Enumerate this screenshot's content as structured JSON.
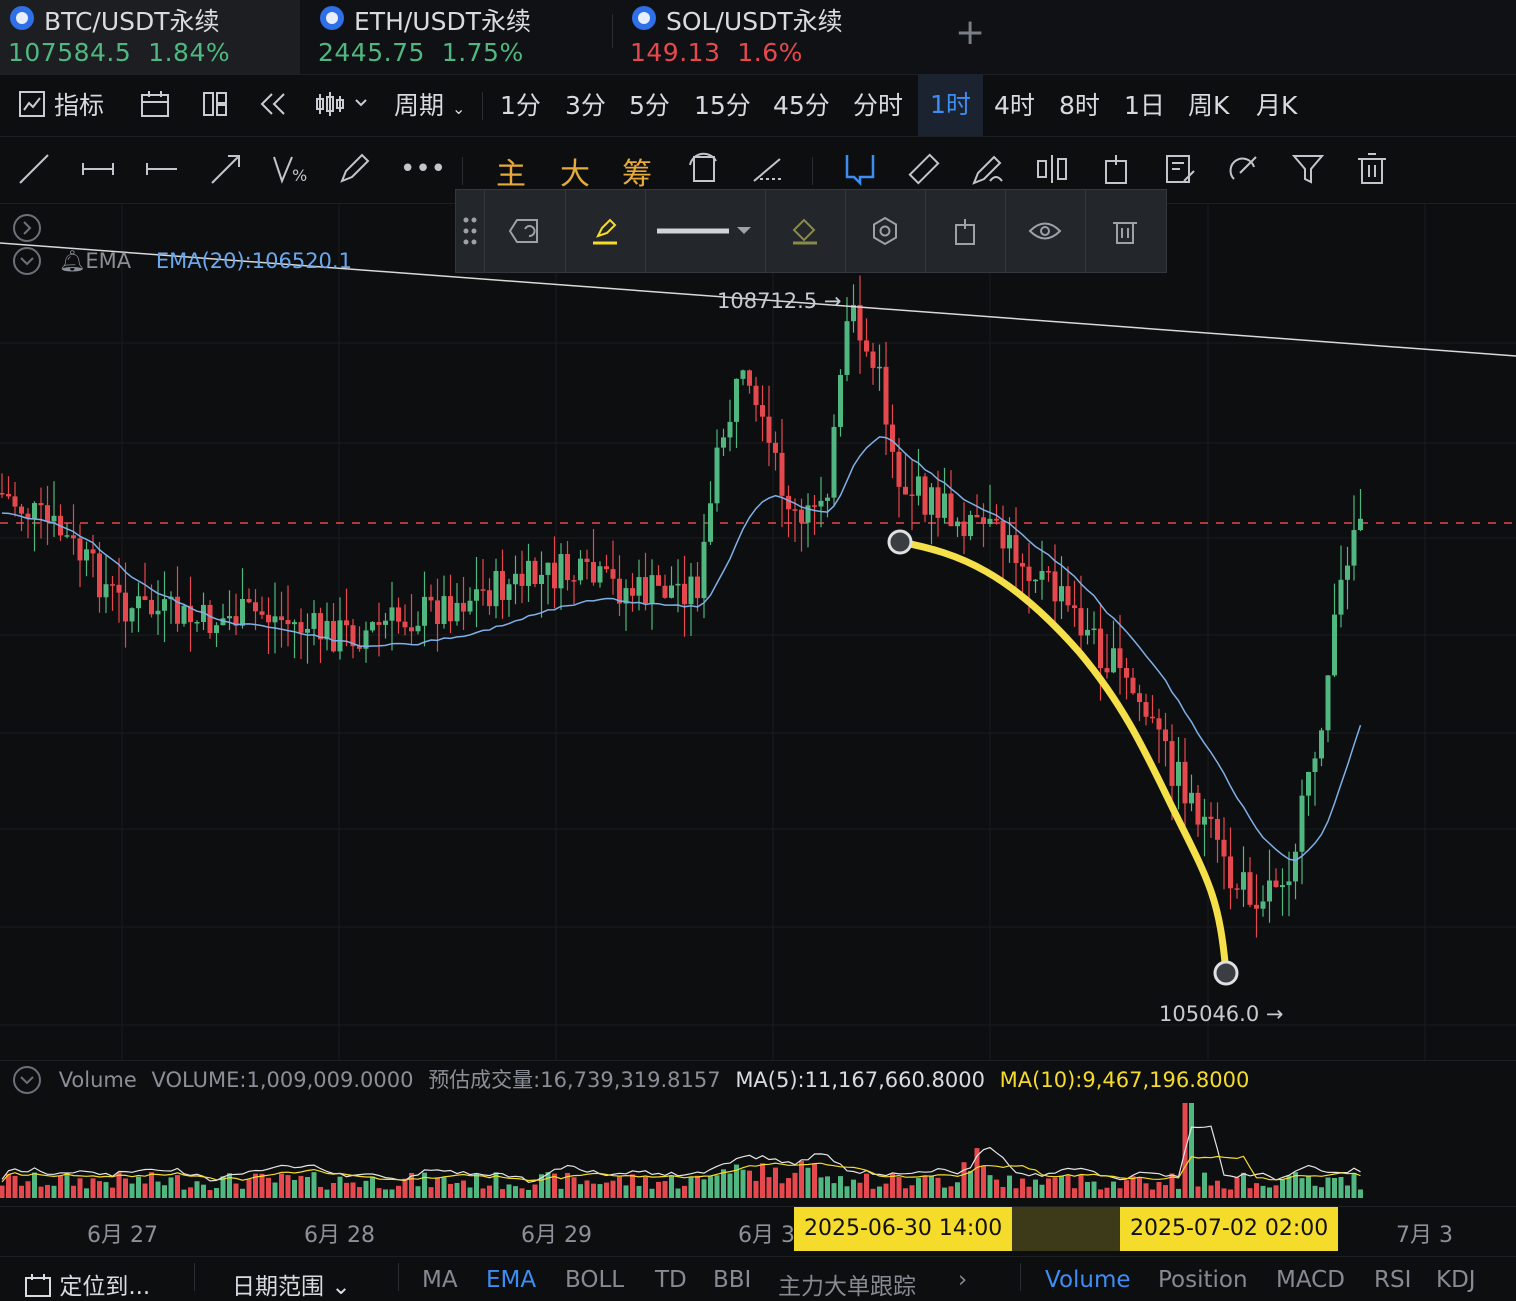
{
  "tabs": [
    {
      "symbol": "BTC/USDT永续",
      "price": "107584.5",
      "change": "1.84%"
    },
    {
      "symbol": "ETH/USDT永续",
      "price": "2445.75",
      "change": "1.75%"
    },
    {
      "symbol": "SOL/USDT永续",
      "price": "149.13",
      "change": "1.6%"
    }
  ],
  "add_tab_label": "+",
  "period_bar": {
    "indicator": "指标",
    "cycle": "周期",
    "intervals": [
      "1分",
      "3分",
      "5分",
      "15分",
      "45分",
      "分时",
      "1时",
      "4时",
      "8时",
      "1日",
      "周K",
      "月K"
    ],
    "active_interval": "1时"
  },
  "draw_toolbar": {
    "main": "主",
    "big": "大",
    "chip": "筹"
  },
  "legend": {
    "ema_name": "EMA",
    "ema_value": "EMA(20):106520.1"
  },
  "price_labels": {
    "high": "108712.5 →",
    "low": "105046.0 →"
  },
  "volume_legend": {
    "name": "Volume",
    "volume": "VOLUME:1,009,009.0000",
    "estimate": "预估成交量:16,739,319.8157",
    "ma5": "MA(5):11,167,660.8000",
    "ma10": "MA(10):9,467,196.8000"
  },
  "x_axis": {
    "ticks": [
      "6月 27",
      "6月 28",
      "6月 29",
      "6月 3",
      "7月 3"
    ],
    "range_start": "2025-06-30 14:00",
    "range_end": "2025-07-02 02:00"
  },
  "bottom_bar": {
    "locate": "定位到...",
    "date_range": "日期范围",
    "main_indicators": [
      "MA",
      "EMA",
      "BOLL",
      "TD",
      "BBI",
      "主力大单跟踪"
    ],
    "active_main": "EMA",
    "sub_indicators": [
      "Volume",
      "Position",
      "MACD",
      "RSI",
      "KDJ"
    ],
    "active_sub": "Volume"
  },
  "colors": {
    "up": "#4fb77f",
    "down": "#e5484d",
    "accent": "#3c8ef5",
    "highlight": "#f5dc2a",
    "ema": "#7fb0e8"
  },
  "chart_data": {
    "type": "candlestick",
    "current_price_line": 107584.5,
    "marked_high": 108712.5,
    "marked_low": 105046.0,
    "ema_period": 20,
    "ema_last": 106520.1
  }
}
